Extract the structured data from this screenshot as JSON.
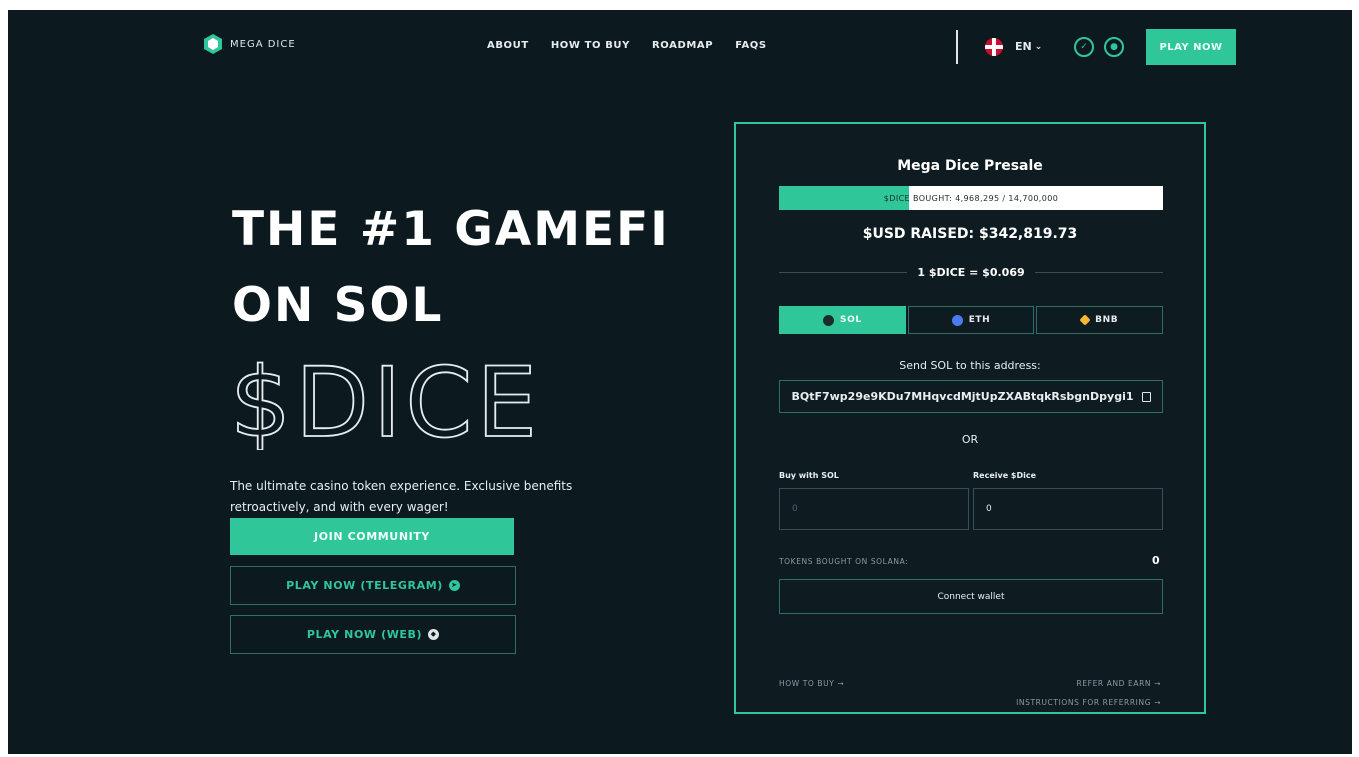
{
  "header": {
    "logo_text": "MEGA DICE",
    "nav": [
      "ABOUT",
      "HOW TO BUY",
      "ROADMAP",
      "FAQS"
    ],
    "language": "EN",
    "play_now": "PLAY NOW"
  },
  "hero": {
    "title_line1": "THE #1 GAMEFI",
    "title_line2": "ON SOL",
    "ticker": "$DICE",
    "description": "The ultimate casino token experience. Exclusive benefits retroactively, and with every wager!",
    "join_button": "JOIN COMMUNITY",
    "telegram_button": "PLAY NOW (TELEGRAM)",
    "web_button": "PLAY NOW (WEB)"
  },
  "presale": {
    "title": "Mega Dice Presale",
    "bought_label": "$DICE BOUGHT: 4,968,295 / 14,700,000",
    "progress_fraction": 0.338,
    "raised": "$USD RAISED: $342,819.73",
    "rate": "1 $DICE = $0.069",
    "tabs": [
      {
        "label": "SOL",
        "active": true,
        "coin_color": "#1b2b30"
      },
      {
        "label": "ETH",
        "active": false,
        "coin_color": "#4a7bf0"
      },
      {
        "label": "BNB",
        "active": false,
        "coin_color": "#f3ba2f"
      }
    ],
    "send_label": "Send SOL to this address:",
    "address": "BQtF7wp29e9KDu7MHqvcdMjtUpZXABtqkRsbgnDpygi1",
    "or": "OR",
    "buy_label": "Buy with SOL",
    "buy_placeholder": "0",
    "receive_label": "Receive $Dice",
    "receive_value": "0",
    "tokens_label": "TOKENS BOUGHT ON SOLANA:",
    "tokens_value": "0",
    "connect": "Connect wallet",
    "how_to_buy": "HOW TO BUY →",
    "refer": "REFER AND EARN →",
    "instructions": "INSTRUCTIONS FOR REFERRING →"
  },
  "colors": {
    "background": "#0c1a1f",
    "accent": "#2fc79a",
    "border": "#2e6e66"
  }
}
